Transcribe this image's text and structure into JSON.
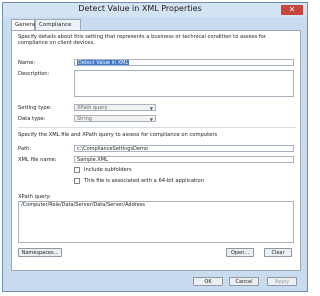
{
  "window": {
    "title": "Detect Value in XML Properties"
  },
  "tabs": [
    {
      "label": "General"
    },
    {
      "label": "Compliance Rules"
    }
  ],
  "intro": "Specify details about this setting that represents a business or technical condition to assess for compliance on client devices.",
  "labels": {
    "name": "Name:",
    "description": "Description:",
    "setting_type": "Setting type:",
    "data_type": "Data type:",
    "xml_intro": "Specify the XML file and XPath query to assess for compliance on computers",
    "path": "Path:",
    "xml_file_name": "XML file name:",
    "include_subfolders": "Include subfolders",
    "bit64": "This file is associated with a 64-bit application",
    "xpath_query": "XPath query:"
  },
  "fields": {
    "name": "Detect Value in XML",
    "description": "",
    "setting_type": "XPath query",
    "data_type": "String",
    "path": "c:\\ComplianceSettingsDemo",
    "xml_file_name": "Sample.XML",
    "xpath_query": "/Computer/Role/Data/Server/Data/Server/Address"
  },
  "buttons": {
    "namespaces": "Namespaces...",
    "open": "Open...",
    "clear": "Clear",
    "ok": "OK",
    "cancel": "Cancel",
    "apply": "Apply"
  }
}
